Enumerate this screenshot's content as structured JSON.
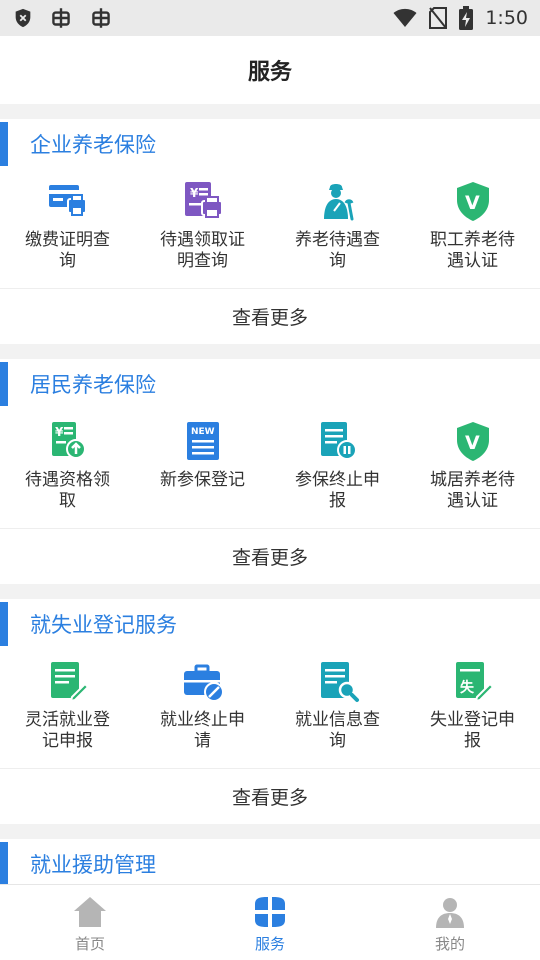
{
  "status_bar": {
    "time": "1:50"
  },
  "header": {
    "title": "服务"
  },
  "sections": [
    {
      "title": "企业养老保险",
      "items": [
        {
          "label": "缴费证明查询",
          "icon": "card-printer-icon"
        },
        {
          "label": "待遇领取证明查询",
          "icon": "yen-printer-icon"
        },
        {
          "label": "养老待遇查询",
          "icon": "elderly-person-icon"
        },
        {
          "label": "职工养老待遇认证",
          "icon": "verified-shield-icon"
        }
      ],
      "more": "查看更多"
    },
    {
      "title": "居民养老保险",
      "items": [
        {
          "label": "待遇资格领取",
          "icon": "yen-document-upload-icon"
        },
        {
          "label": "新参保登记",
          "icon": "new-document-icon"
        },
        {
          "label": "参保终止申报",
          "icon": "document-pause-icon"
        },
        {
          "label": "城居养老待遇认证",
          "icon": "verified-shield-icon"
        }
      ],
      "more": "查看更多"
    },
    {
      "title": "就失业登记服务",
      "items": [
        {
          "label": "灵活就业登记申报",
          "icon": "document-edit-icon"
        },
        {
          "label": "就业终止申请",
          "icon": "briefcase-stop-icon"
        },
        {
          "label": "就业信息查询",
          "icon": "document-search-icon"
        },
        {
          "label": "失业登记申报",
          "icon": "unemployment-edit-icon"
        }
      ],
      "more": "查看更多"
    },
    {
      "title": "就业援助管理",
      "items": [],
      "more": ""
    }
  ],
  "tabs": [
    {
      "label": "首页",
      "icon": "home-icon",
      "active": false
    },
    {
      "label": "服务",
      "icon": "services-grid-icon",
      "active": true
    },
    {
      "label": "我的",
      "icon": "profile-icon",
      "active": false
    }
  ],
  "colors": {
    "accent": "#2b7fe0",
    "green": "#2bb673",
    "purple": "#7e57c2",
    "teal": "#1aa3b8"
  }
}
